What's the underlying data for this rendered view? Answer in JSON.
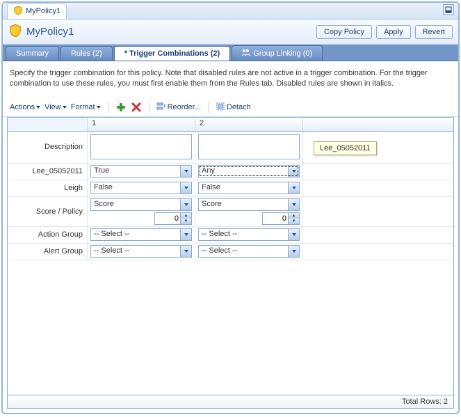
{
  "doc_tab": "MyPolicy1",
  "header": {
    "title": "MyPolicy1",
    "copy": "Copy Policy",
    "apply": "Apply",
    "revert": "Revert"
  },
  "tabs": {
    "summary": "Summary",
    "rules": "Rules (2)",
    "trigger": "* Trigger Combinations (2)",
    "group": "Group Linking (0)"
  },
  "intro": "Specify the trigger combination for this policy. Note that disabled rules are not active in a trigger combination. For the trigger combination to use these rules, you must first enable them from the Rules tab. Disabled rules are shown in italics.",
  "toolbar": {
    "actions": "Actions",
    "view": "View",
    "format": "Format",
    "reorder": "Reorder...",
    "detach": "Detach"
  },
  "grid": {
    "col1": "1",
    "col2": "2",
    "rows": {
      "description": "Description",
      "lee": "Lee_05052011",
      "leigh": "Leigh",
      "score": "Score / Policy",
      "action": "Action Group",
      "alert": "Alert Group"
    },
    "values": {
      "lee1": "True",
      "lee2": "Any",
      "leigh1": "False",
      "leigh2": "False",
      "score1": "Score",
      "score2": "Score",
      "score1v": "0",
      "score2v": "0",
      "action1": "-- Select --",
      "action2": "-- Select --",
      "alert1": "-- Select --",
      "alert2": "-- Select --"
    }
  },
  "tooltip": "Lee_05052011",
  "footer": "Total Rows: 2"
}
